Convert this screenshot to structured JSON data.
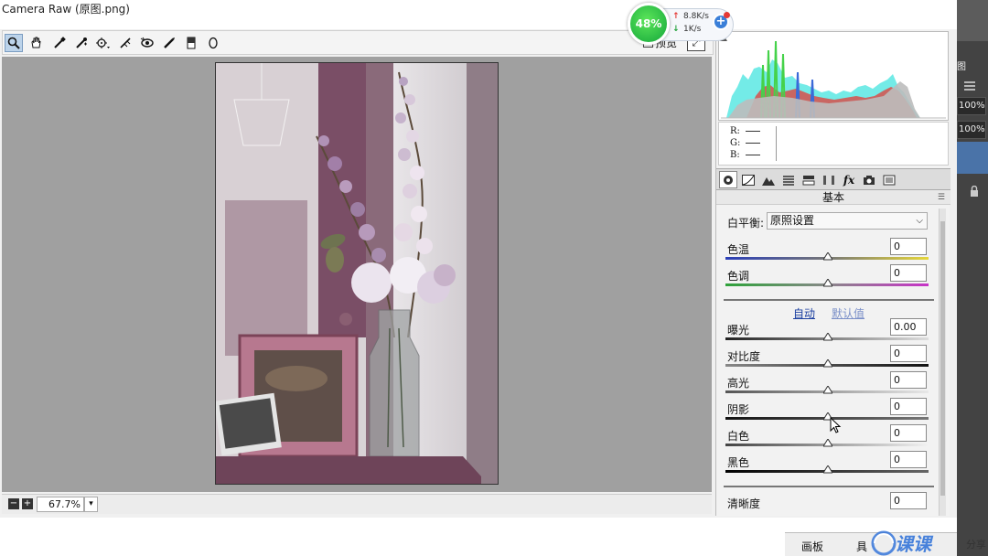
{
  "window": {
    "title": "Camera Raw (原图.png)"
  },
  "toolbar": {
    "tools": [
      "zoom-tool-icon",
      "hand-tool-icon",
      "white-balance-tool-icon",
      "color-sampler-tool-icon",
      "targeted-adjustment-tool-icon",
      "straighten-tool-icon",
      "spot-removal-tool-icon",
      "red-eye-removal-tool-icon",
      "adjustment-brush-icon",
      "graduated-filter-icon",
      "radial-filter-icon"
    ],
    "preview_label": "预览"
  },
  "zoom": {
    "value": "67.7%"
  },
  "histogram": {
    "labels": [
      "R:",
      "G:",
      "B:"
    ],
    "values": [
      "—",
      "—",
      "—"
    ]
  },
  "panel": {
    "section_title": "基本",
    "white_balance_label": "白平衡:",
    "white_balance_value": "原照设置",
    "auto_label": "自动",
    "default_label": "默认值",
    "controls": [
      {
        "label": "色温",
        "value": "0"
      },
      {
        "label": "色调",
        "value": "0"
      },
      {
        "label": "曝光",
        "value": "0.00"
      },
      {
        "label": "对比度",
        "value": "0"
      },
      {
        "label": "高光",
        "value": "0"
      },
      {
        "label": "阴影",
        "value": "0"
      },
      {
        "label": "白色",
        "value": "0"
      },
      {
        "label": "黑色",
        "value": "0"
      },
      {
        "label": "清晰度",
        "value": "0"
      }
    ]
  },
  "network_widget": {
    "percent": "48%",
    "upload": "8.8K/s",
    "download": "1K/s"
  },
  "ps_side": {
    "item_top": "图",
    "zoom_a": "100%",
    "zoom_b": "100%"
  },
  "bottom": {
    "panel_label": "画板",
    "tools_label": "具",
    "share_label": "分享"
  },
  "colors": {
    "canvas": "#a0a0a0",
    "accent_blue": "#4a73a8",
    "net_green": "#22b14c"
  }
}
